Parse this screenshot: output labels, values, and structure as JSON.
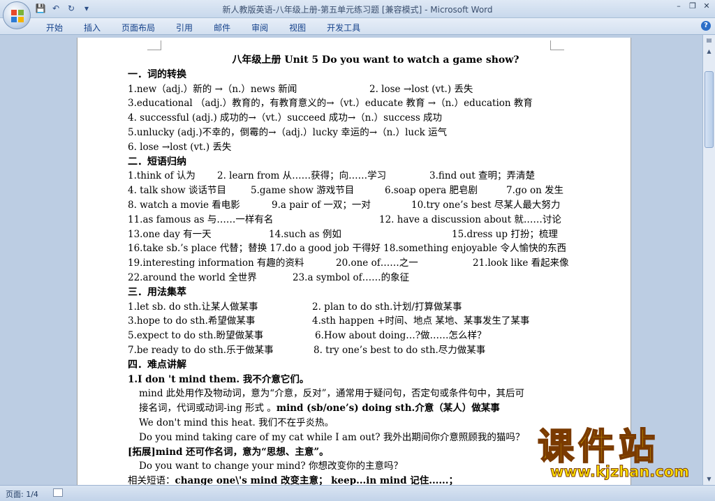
{
  "window": {
    "title": "新人教版英语-八年级上册-第五单元练习题 [兼容模式] - Microsoft Word"
  },
  "ribbon": {
    "tabs": [
      "开始",
      "插入",
      "页面布局",
      "引用",
      "邮件",
      "审阅",
      "视图",
      "开发工具"
    ],
    "help_label": "?"
  },
  "status": {
    "page": "页面: 1/4"
  },
  "doc": {
    "title": "八年级上册 Unit 5    Do you want to watch a game show?",
    "s1_head": "一．词的转换",
    "s1_lines": [
      "1.new（adj.）新的 →（n.）news    新闻",
      "3.educational  （adj.）教育的，有教育意义的→（vt.）educate 教育 →（n.）education 教育",
      "4. successful (adj.) 成功的→（vt.）succeed 成功→（n.）success 成功",
      "5.unlucky (adj.)不幸的，倒霉的→（adj.）lucky 幸运的→（n.）luck 运气",
      "6. lose →lost (vt.) 丢失"
    ],
    "s1_line1b": "2. lose →lost (vt.) 丢失",
    "s2_head": "二．短语归纳",
    "s2_rows": [
      [
        "1.think of 认为",
        "2. learn from 从……获得；向……学习",
        "3.find out 查明；弄清楚"
      ],
      [
        "4. talk show 谈话节目",
        "5.game show 游戏节目",
        "6.soap opera 肥皂剧",
        "7.go on 发生"
      ],
      [
        "8. watch a movie 看电影",
        "9.a pair of 一双；一对",
        "10.try one’s best 尽某人最大努力"
      ],
      [
        "11.as famous as 与……一样有名",
        "12. have a discussion about 就……讨论"
      ],
      [
        "13.one day 有一天",
        "14.such as 例如",
        "15.dress up 打扮；梳理"
      ],
      [
        "16.take sb.’s place 代替；替换 17.do a good job 干得好  18.something enjoyable 令人愉快的东西"
      ],
      [
        "19.interesting information 有趣的资料",
        "20.one of……之一",
        "21.look like 看起来像"
      ],
      [
        "22.around the world 全世界",
        "23.a symbol of……的象征"
      ]
    ],
    "s3_head": "三．用法集萃",
    "s3_rows": [
      [
        "1.let sb. do sth.让某人做某事",
        "2. plan to do sth.计划/打算做某事"
      ],
      [
        "3.hope to do sth.希望做某事",
        "4.sth    happen +时间、地点    某地、某事发生了某事"
      ],
      [
        "5.expect to do sth.盼望做某事",
        "6.How about doing…?做……怎么样？"
      ],
      [
        "7.be ready to do sth.乐于做某事",
        "8. try one’s best to do sth.尽力做某事"
      ]
    ],
    "s4_head": "四．难点讲解",
    "s4_item1": "1.I don 't mind them.  我不介意它们。",
    "s4_p1": "mind  此处用作及物动词，意为“介意，反对”，通常用于疑问句，否定句或条件句中，其后可",
    "s4_p2a": "接名词，代词或动词-ing 形式 。",
    "s4_p2b": "mind    (sb/one’s) doing sth.介意（某人）做某事",
    "s4_p3": "We don't mind this heat. 我们不在乎炎热。",
    "s4_p4": "Do you mind taking care of my cat while I am out? 我外出期间你介意照顾我的猫吗？",
    "s4_ext": "[拓展]mind  还可作名词，意为“思想、主意”。",
    "s4_p5": "Do you want to change your mind? 你想改变你的主意吗？",
    "s4_p6a": "相关短语：",
    "s4_p6b": "change one\\'s mind  改变主意；  keep...in mind 记住......；"
  },
  "watermark": {
    "big": "课件站",
    "url": "www.kjzhan.com"
  }
}
